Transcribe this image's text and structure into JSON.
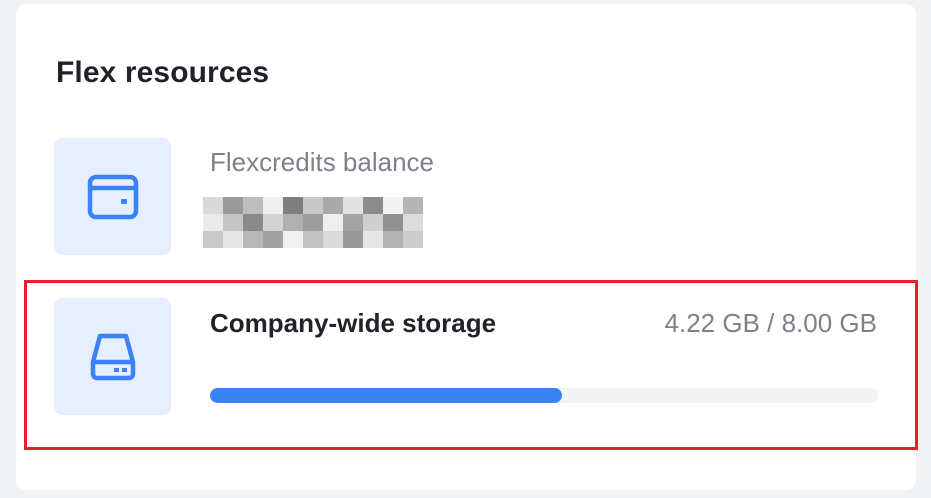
{
  "card": {
    "title": "Flex resources"
  },
  "flexcredits": {
    "label": "Flexcredits balance",
    "icon": "wallet-icon",
    "value_redacted": true
  },
  "storage": {
    "label": "Company-wide storage",
    "value_text": "4.22 GB / 8.00 GB",
    "used_gb": 4.22,
    "total_gb": 8.0,
    "progress_fraction": 0.5275,
    "icon": "hard-drive-icon"
  },
  "colors": {
    "accent": "#3b82f6",
    "tile_bg": "#e6efff",
    "highlight": "#e5202e",
    "title": "#1f2329",
    "muted": "#7c818a"
  }
}
